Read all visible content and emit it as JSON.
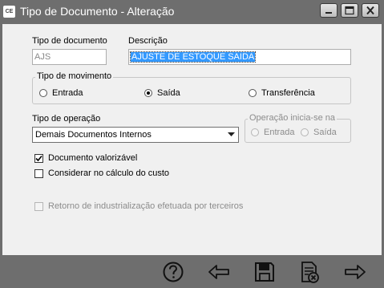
{
  "window": {
    "title": "Tipo de Documento - Alteração",
    "app_icon_text": "CE",
    "controls": [
      "minimize-icon",
      "maximize-icon",
      "close-icon"
    ]
  },
  "form": {
    "tipo_documento": {
      "label": "Tipo de documento",
      "value": "AJS"
    },
    "descricao": {
      "label": "Descrição",
      "value": "AJUSTE DE ESTOQUE SAIDA"
    },
    "tipo_movimento": {
      "legend": "Tipo de movimento",
      "options": [
        "Entrada",
        "Saída",
        "Transferência"
      ],
      "selected": "Saída"
    },
    "tipo_operacao": {
      "label": "Tipo de operação",
      "value": "Demais Documentos Internos"
    },
    "operacao_inicia": {
      "legend": "Operação inicia-se na",
      "options": [
        "Entrada",
        "Saída"
      ]
    },
    "documento_valorizavel": {
      "label": "Documento valorizável",
      "checked": true
    },
    "considerar_custo": {
      "label": "Considerar no cálculo do custo",
      "checked": false
    },
    "retorno_industrializacao": {
      "label": "Retorno de industrialização efetuada por terceiros",
      "checked": false,
      "disabled": true
    }
  },
  "toolbar": {
    "buttons": [
      "help-icon",
      "back-arrow-icon",
      "save-icon",
      "delete-document-icon",
      "forward-arrow-icon"
    ]
  },
  "colors": {
    "frame": "#6e6e6e",
    "client": "#f0f0f0",
    "selection": "#3399ff"
  }
}
